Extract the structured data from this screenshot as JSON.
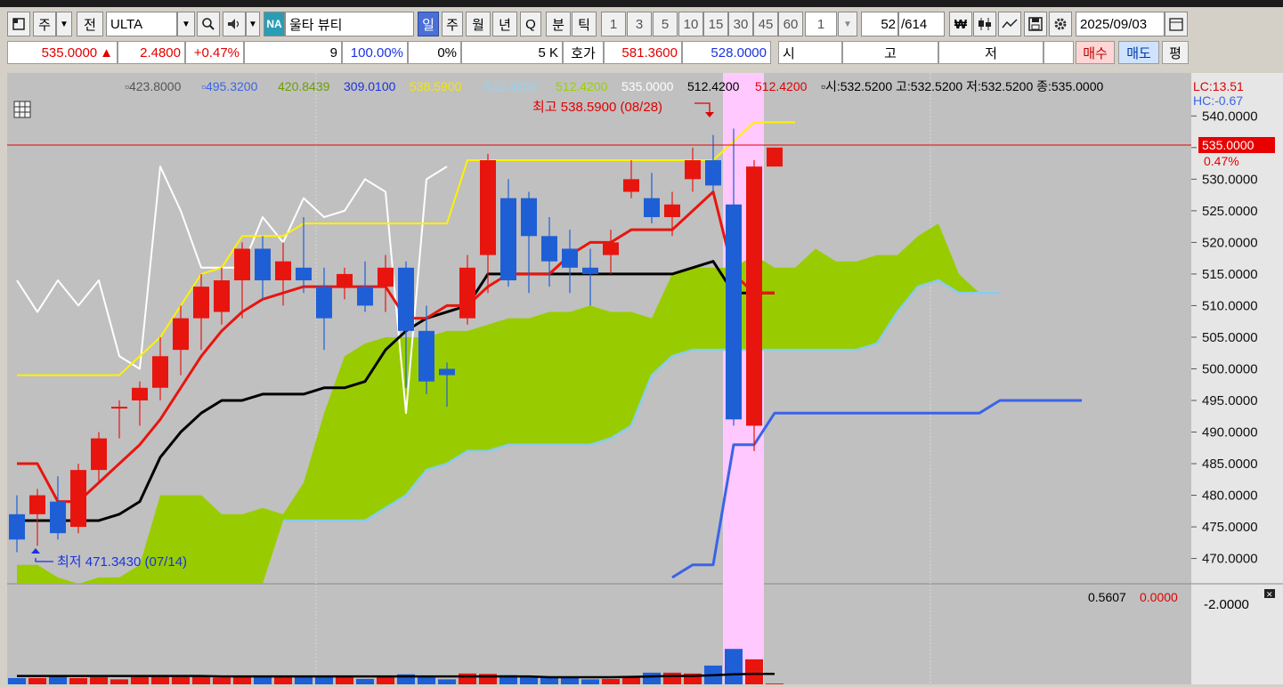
{
  "toolbar": {
    "market_btn": "주",
    "prev_btn": "전",
    "symbol": "ULTA",
    "exchange_badge": "NA",
    "company_name": "울타 뷰티",
    "periods": [
      "일",
      "주",
      "월",
      "년",
      "Q",
      "분",
      "틱"
    ],
    "intervals": [
      "1",
      "3",
      "5",
      "10",
      "15",
      "30",
      "45",
      "60"
    ],
    "multiplier": "1",
    "count_current": "52",
    "count_total": "/614",
    "date": "2025/09/03"
  },
  "quote": {
    "price": "535.0000",
    "change_arrow": "▲",
    "change": "2.4800",
    "change_pct": "+0.47%",
    "field_9": "9",
    "pct_100": "100.00%",
    "pct_0": "0%",
    "qty": "5 K",
    "hoga_label": "호가",
    "hoga_ask": "581.3600",
    "hoga_bid": "528.0000",
    "open_label": "시",
    "high_label": "고",
    "low_label": "저",
    "buy_label": "매수",
    "sell_label": "매도",
    "extra_label": "평"
  },
  "legend": {
    "v1": "423.8000",
    "v2": "495.3200",
    "v3": "420.8439",
    "v4": "309.0100",
    "v5": "538.5900",
    "v6": "512.4200",
    "v7": "512.4200",
    "v8": "535.0000",
    "v9": "512.4200",
    "v10": "512.4200",
    "ohlc": "시:532.5200 고:532.5200 저:532.5200 종:535.0000",
    "lc": "LC:13.51",
    "hc": "HC:-0.67"
  },
  "annotations": {
    "high_note": "최고 538.5900 (08/28)",
    "low_note": "최저 471.3430 (07/14)",
    "last_price_tag": "535.0000",
    "last_pct_tag": "0.47%"
  },
  "volume_legend": {
    "v1": "0.5607",
    "v2": "0.0000",
    "axis_top": "2.0000"
  },
  "colors": {
    "up": "#e8150f",
    "down": "#1e5fd6",
    "tenkan": "#e8150f",
    "kijun": "#000000",
    "span_a": "#fff200",
    "chikou": "#ffffff",
    "cloud": "#99cc00",
    "span_b_line": "#88ccee",
    "lower_line": "#3a64e6",
    "highlight": "#ffc8ff"
  },
  "chart_data": {
    "type": "candlestick",
    "ylim": [
      466,
      543
    ],
    "yticks": [
      "540.0000",
      "535.0000",
      "530.0000",
      "525.0000",
      "520.0000",
      "515.0000",
      "510.0000",
      "505.0000",
      "500.0000",
      "495.0000",
      "490.0000",
      "485.0000",
      "480.0000",
      "475.0000",
      "470.0000"
    ],
    "candles": [
      {
        "o": 477,
        "c": 473,
        "h": 480,
        "l": 471
      },
      {
        "o": 477,
        "c": 480,
        "h": 481,
        "l": 472
      },
      {
        "o": 479,
        "c": 474,
        "h": 483,
        "l": 473
      },
      {
        "o": 475,
        "c": 484,
        "h": 485,
        "l": 474
      },
      {
        "o": 484,
        "c": 489,
        "h": 490,
        "l": 482
      },
      {
        "o": 494,
        "c": 494,
        "h": 495,
        "l": 489
      },
      {
        "o": 495,
        "c": 497,
        "h": 498,
        "l": 491
      },
      {
        "o": 497,
        "c": 502,
        "h": 505,
        "l": 495
      },
      {
        "o": 503,
        "c": 508,
        "h": 510,
        "l": 499
      },
      {
        "o": 508,
        "c": 513,
        "h": 515,
        "l": 503
      },
      {
        "o": 509,
        "c": 514,
        "h": 516,
        "l": 507
      },
      {
        "o": 514,
        "c": 519,
        "h": 520,
        "l": 508
      },
      {
        "o": 519,
        "c": 514,
        "h": 521,
        "l": 511
      },
      {
        "o": 514,
        "c": 517,
        "h": 520,
        "l": 510
      },
      {
        "o": 516,
        "c": 514,
        "h": 524,
        "l": 512
      },
      {
        "o": 513,
        "c": 508,
        "h": 516,
        "l": 503
      },
      {
        "o": 513,
        "c": 515,
        "h": 516,
        "l": 511
      },
      {
        "o": 513,
        "c": 510,
        "h": 517,
        "l": 509
      },
      {
        "o": 513,
        "c": 516,
        "h": 518,
        "l": 509
      },
      {
        "o": 516,
        "c": 506,
        "h": 517,
        "l": 497
      },
      {
        "o": 506,
        "c": 498,
        "h": 510,
        "l": 496
      },
      {
        "o": 500,
        "c": 499,
        "h": 501,
        "l": 494
      },
      {
        "o": 508,
        "c": 516,
        "h": 518,
        "l": 507
      },
      {
        "o": 518,
        "c": 533,
        "h": 534,
        "l": 512
      },
      {
        "o": 527,
        "c": 514,
        "h": 530,
        "l": 513
      },
      {
        "o": 527,
        "c": 521,
        "h": 528,
        "l": 512
      },
      {
        "o": 521,
        "c": 517,
        "h": 524,
        "l": 513
      },
      {
        "o": 519,
        "c": 516,
        "h": 522,
        "l": 512
      },
      {
        "o": 516,
        "c": 515,
        "h": 519,
        "l": 510
      },
      {
        "o": 518,
        "c": 520,
        "h": 522,
        "l": 515
      },
      {
        "o": 528,
        "c": 530,
        "h": 533,
        "l": 527
      },
      {
        "o": 527,
        "c": 524,
        "h": 531,
        "l": 523
      },
      {
        "o": 524,
        "c": 526,
        "h": 528,
        "l": 521
      },
      {
        "o": 530,
        "c": 533,
        "h": 535,
        "l": 528
      },
      {
        "o": 533,
        "c": 529,
        "h": 537,
        "l": 528
      },
      {
        "o": 526,
        "c": 492,
        "h": 538,
        "l": 491
      },
      {
        "o": 491,
        "c": 532,
        "h": 533,
        "l": 487
      },
      {
        "o": 532,
        "c": 535,
        "h": 535,
        "l": 532
      }
    ],
    "tenkan": [
      485,
      485,
      479,
      479,
      482,
      485,
      488,
      492,
      497,
      502,
      506,
      509,
      511,
      512,
      513,
      513,
      513,
      513,
      513,
      508,
      508,
      510,
      510,
      513,
      515,
      515,
      515,
      518,
      520,
      520,
      522,
      522,
      522,
      525,
      528,
      515,
      512,
      512
    ],
    "kijun": [
      476,
      476,
      476,
      476,
      476,
      477,
      479,
      486,
      490,
      493,
      495,
      495,
      496,
      496,
      496,
      497,
      497,
      498,
      503,
      506,
      508,
      509,
      510,
      515,
      515,
      515,
      515,
      515,
      515,
      515,
      515,
      515,
      515,
      516,
      517,
      512,
      512,
      512
    ],
    "span_a": [
      499,
      499,
      499,
      499,
      499,
      499,
      502,
      505,
      510,
      515,
      516,
      521,
      521,
      521,
      523,
      523,
      523,
      523,
      523,
      523,
      523,
      523,
      533,
      533,
      533,
      533,
      533,
      533,
      533,
      533,
      533,
      533,
      533,
      533,
      533,
      536,
      539,
      539,
      539
    ],
    "chikou": [
      514,
      509,
      514,
      510,
      514,
      502,
      500,
      532,
      525,
      516,
      516,
      516,
      524,
      520,
      527,
      524,
      525,
      530,
      528,
      493,
      530,
      532
    ],
    "cloud_top": [
      469,
      469,
      467,
      466,
      467,
      467,
      469,
      480,
      480,
      480,
      477,
      477,
      478,
      477,
      482,
      493,
      502,
      504,
      505,
      505,
      505,
      506,
      506,
      507,
      508,
      508,
      509,
      509,
      510,
      509,
      509,
      508,
      515,
      516,
      516,
      516,
      518,
      516,
      516,
      519,
      517,
      517,
      518,
      518,
      521,
      523,
      515,
      512,
      512
    ],
    "cloud_bottom": [
      466,
      466,
      466,
      466,
      466,
      466,
      466,
      466,
      466,
      466,
      466,
      466,
      466,
      476,
      476,
      476,
      476,
      476,
      478,
      480,
      484,
      485,
      487,
      487,
      488,
      488,
      488,
      488,
      488,
      489,
      491,
      499,
      502,
      503,
      503,
      503,
      503,
      503,
      503,
      503,
      503,
      503,
      504,
      509,
      513,
      514,
      512,
      512,
      512
    ],
    "lower_line": [
      467,
      469,
      469,
      488,
      488,
      493,
      493,
      493,
      493,
      493,
      493,
      493,
      493,
      493,
      493,
      493,
      495,
      495,
      495,
      495,
      495
    ],
    "volume": [
      0.15,
      0.15,
      0.2,
      0.15,
      0.17,
      0.12,
      0.18,
      0.18,
      0.2,
      0.18,
      0.16,
      0.2,
      0.18,
      0.2,
      0.17,
      0.2,
      0.18,
      0.13,
      0.2,
      0.24,
      0.2,
      0.12,
      0.26,
      0.25,
      0.22,
      0.2,
      0.15,
      0.19,
      0.12,
      0.13,
      0.2,
      0.28,
      0.28,
      0.26,
      0.45,
      0.85,
      0.6,
      0.02
    ],
    "volume_ma": [
      0.2,
      0.2,
      0.2,
      0.2,
      0.2,
      0.2,
      0.2,
      0.2,
      0.2,
      0.2,
      0.19,
      0.19,
      0.19,
      0.19,
      0.19,
      0.19,
      0.19,
      0.19,
      0.19,
      0.19,
      0.19,
      0.19,
      0.19,
      0.19,
      0.19,
      0.19,
      0.17,
      0.17,
      0.17,
      0.17,
      0.18,
      0.19,
      0.2,
      0.2,
      0.22,
      0.24,
      0.25,
      0.25
    ],
    "volume_ylim": [
      0,
      2.2
    ]
  }
}
